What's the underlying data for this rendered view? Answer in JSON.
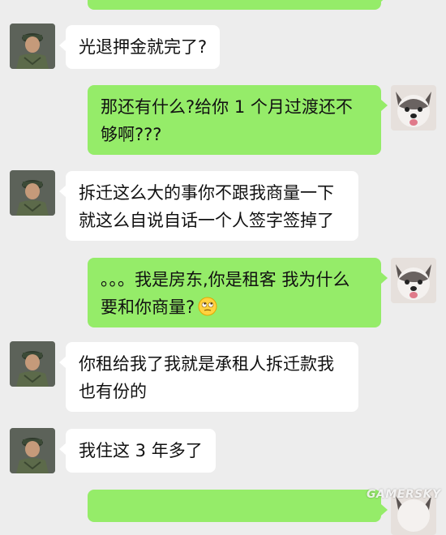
{
  "messages": [
    {
      "side": "out",
      "lines": []
    },
    {
      "side": "in",
      "lines": [
        "光退押金就完了?"
      ]
    },
    {
      "side": "out",
      "lines": [
        "那还有什么?给你 1 个月过渡还不",
        "够啊???"
      ]
    },
    {
      "side": "in",
      "lines": [
        "拆迁这么大的事你不跟我商量一下",
        "就这么自说自话一个人签字签掉了"
      ]
    },
    {
      "side": "out",
      "lines": [
        "。。。我是房东,你是租客 我为什么",
        "要和你商量?"
      ],
      "emoji": "rolling-eyes-emoji"
    },
    {
      "side": "in",
      "lines": [
        "你租给我了我就是承租人拆迁款我",
        "也有份的"
      ]
    },
    {
      "side": "in",
      "lines": [
        "我住这 3 年多了"
      ]
    },
    {
      "side": "out",
      "lines": []
    }
  ],
  "watermark": "GAMERSKY",
  "colors": {
    "background": "#ededed",
    "incoming_bubble": "#ffffff",
    "outgoing_bubble": "#95ec69"
  }
}
